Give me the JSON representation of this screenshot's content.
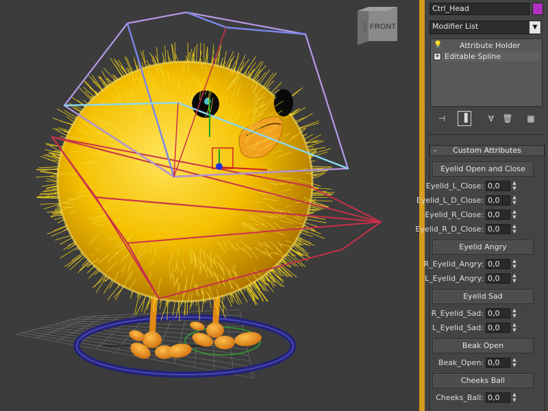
{
  "viewport": {
    "viewcube_label": "FRONT",
    "viewcube_side_label": "LEFT",
    "colors": {
      "background": "#3c3c3c",
      "fur": "#f2d21a",
      "body": "#f5c000",
      "beak": "#f2a020",
      "feet": "#f49a1a",
      "cage": "#c8304a",
      "head_ctrl": "#6a7de0",
      "ground_ctrl": "#2a2a8a",
      "grid": "#8a8a8a"
    }
  },
  "command_panel": {
    "object_name": "Ctrl_Head",
    "object_color": "#b030c0",
    "modifier_list_label": "Modifier List",
    "modifier_stack": [
      {
        "icon": "lightbulb-icon",
        "label": "Attribute Holder"
      },
      {
        "icon": "plus-box-icon",
        "label": "Editable Spline"
      }
    ],
    "stack_tools": [
      "pin-stack-icon",
      "show-end-result-icon",
      "make-unique-icon",
      "remove-modifier-icon",
      "configure-modifier-sets-icon"
    ],
    "rollout": {
      "collapse_symbol": "-",
      "title": "Custom Attributes",
      "groups": [
        {
          "button": "Eyelid Open and Close",
          "params": [
            {
              "label": "Eyelid_L_Close:",
              "value": "0,0"
            },
            {
              "label": "Eyelid_L_D_Close:",
              "value": "0,0"
            },
            {
              "label": "Eyelid_R_Close:",
              "value": "0,0"
            },
            {
              "label": "Eyelid_R_D_Close:",
              "value": "0,0"
            }
          ]
        },
        {
          "button": "Eyelid Angry",
          "params": [
            {
              "label": "R_Eyelid_Angry:",
              "value": "0,0"
            },
            {
              "label": "L_Eyelid_Angry:",
              "value": "0,0"
            }
          ]
        },
        {
          "button": "Eyelid Sad",
          "params": [
            {
              "label": "R_Eyelid_Sad:",
              "value": "0,0"
            },
            {
              "label": "L_Eyelid_Sad:",
              "value": "0,0"
            }
          ]
        },
        {
          "button": "Beak Open",
          "params": [
            {
              "label": "Beak_Open:",
              "value": "0,0"
            }
          ]
        },
        {
          "button": "Cheeks Ball",
          "params": [
            {
              "label": "Cheeks_Ball:",
              "value": "0,0"
            }
          ]
        }
      ]
    }
  }
}
